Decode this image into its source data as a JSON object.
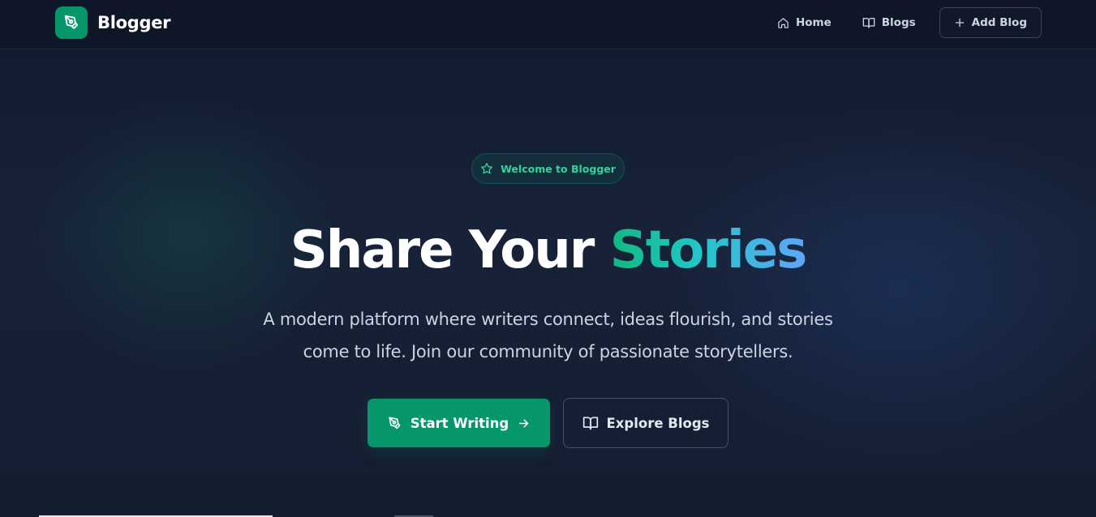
{
  "brand": {
    "name": "Blogger",
    "icon": "pen-tool-icon",
    "color": "#059669"
  },
  "nav": {
    "home": {
      "label": "Home",
      "icon": "home-icon"
    },
    "blogs": {
      "label": "Blogs",
      "icon": "book-open-icon"
    },
    "add_blog": {
      "label": "Add Blog",
      "icon": "plus-icon"
    }
  },
  "hero": {
    "badge": {
      "label": "Welcome to Blogger",
      "icon": "star-icon"
    },
    "headline_main": "Share Your ",
    "headline_accent": "Stories",
    "subtitle_line1": "A modern platform where writers connect, ideas flourish, and stories",
    "subtitle_line2": "come to life. Join our community of passionate storytellers.",
    "primary_button": {
      "label": "Start Writing",
      "icon": "pen-tool-icon",
      "trailing_icon": "arrow-right-icon"
    },
    "secondary_button": {
      "label": "Explore Blogs",
      "icon": "book-open-icon"
    }
  },
  "colors": {
    "accent": "#10b981",
    "accent_gradient_end": "#60a5fa",
    "background": "#0f172a"
  }
}
